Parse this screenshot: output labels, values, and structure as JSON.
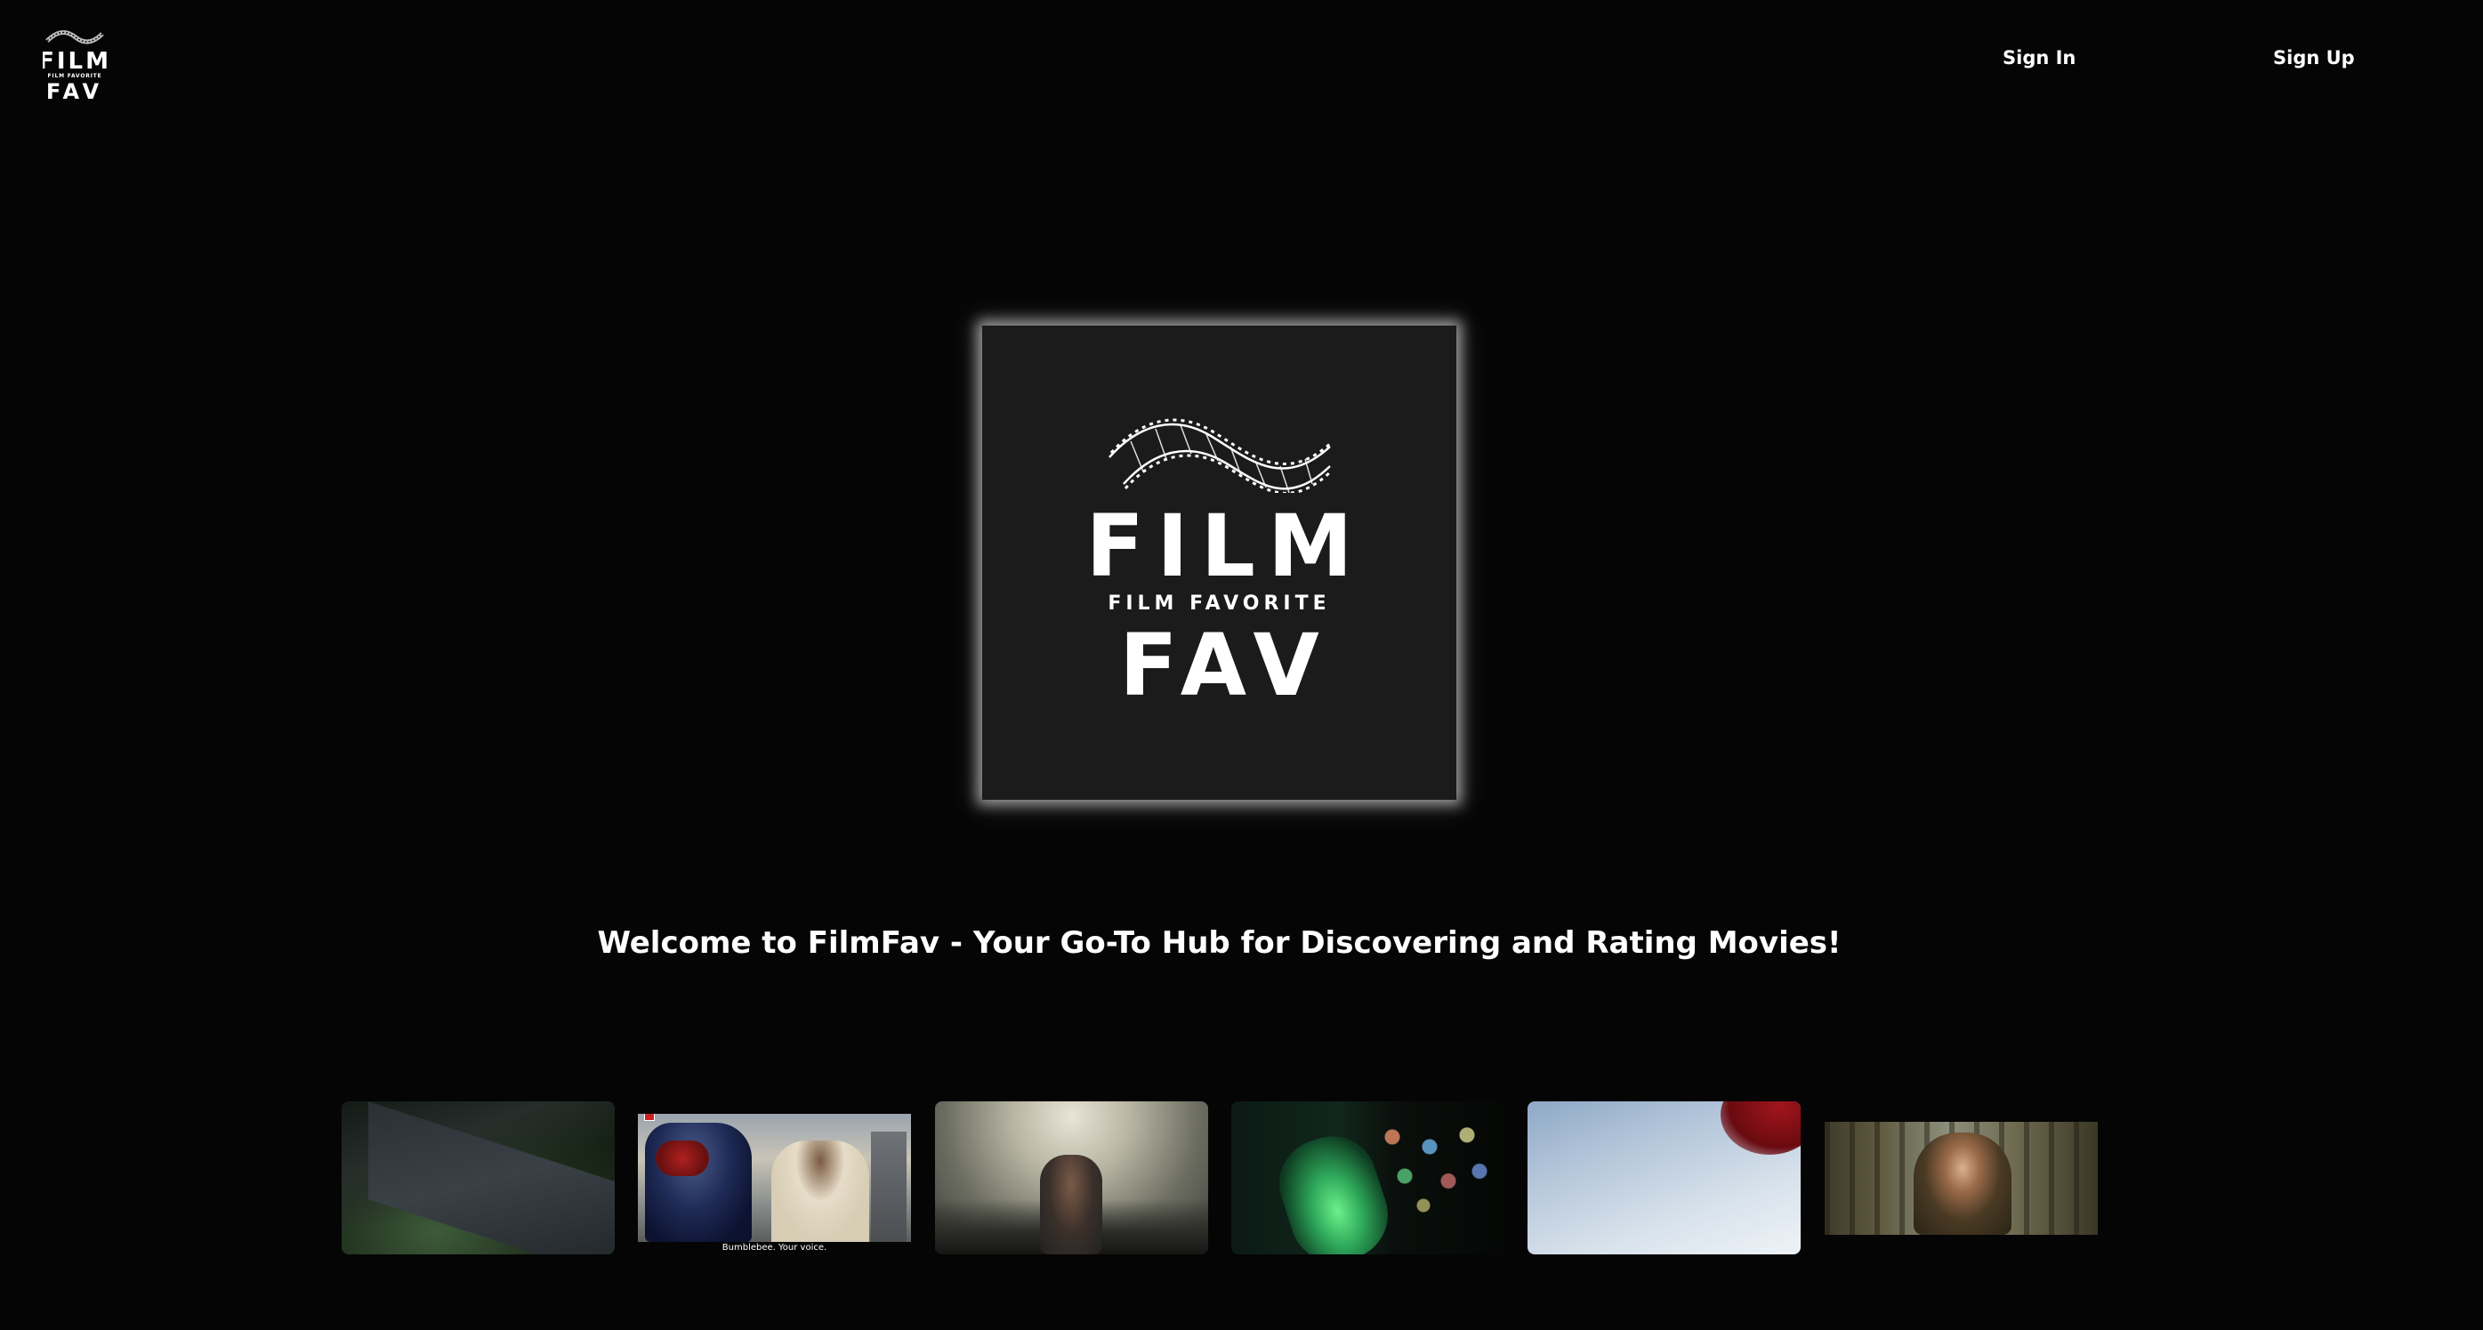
{
  "header": {
    "logo": {
      "top_word": "FILM",
      "sub_word": "FILM FAVORITE",
      "bottom_word": "FAV"
    },
    "nav": {
      "sign_in": "Sign In",
      "sign_up": "Sign Up"
    }
  },
  "hero": {
    "logo": {
      "top_word": "FILM",
      "sub_word": "FILM FAVORITE",
      "bottom_word": "FAV"
    }
  },
  "welcome_text": "Welcome to FilmFav - Your Go-To Hub for Discovering and Rating Movies!",
  "carousel": {
    "thumbnails": [
      {
        "caption": ""
      },
      {
        "caption": "Bumblebee. Your voice."
      },
      {
        "caption": ""
      },
      {
        "caption": ""
      },
      {
        "caption": ""
      },
      {
        "caption": ""
      }
    ]
  },
  "colors": {
    "background": "#050505",
    "logo_tile": "#1b1b1b",
    "text": "#ffffff"
  }
}
